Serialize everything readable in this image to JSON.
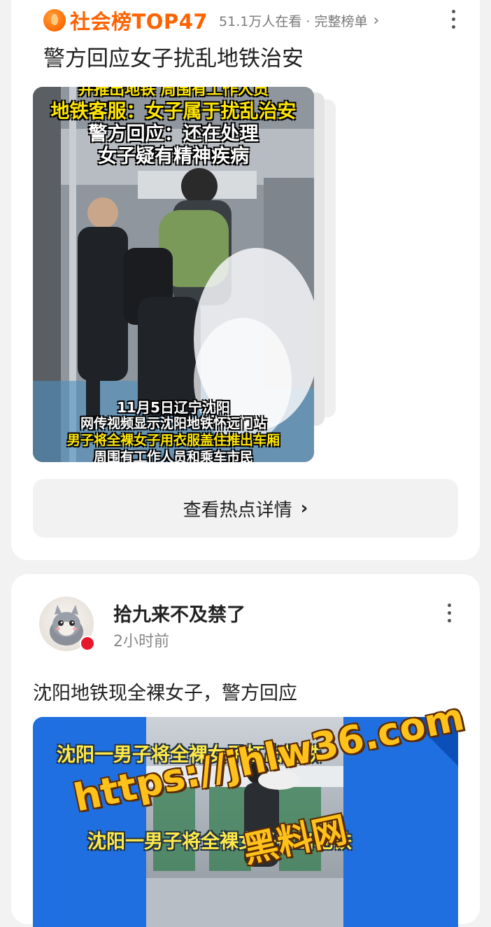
{
  "hot_card": {
    "rank_label": "社会榜TOP47",
    "viewers": "51.1万人在看",
    "separator": "·",
    "full_list_link": "完整榜单",
    "chevron": "›",
    "headline": "警方回应女子扰乱地铁治安",
    "image_captions_top": [
      "并推出地铁 周围有工作人员",
      "地铁客服：女子属于扰乱治安",
      "警方回应：还在处理",
      "女子疑有精神疾病"
    ],
    "image_captions_bottom": [
      "11月5日辽宁沈阳",
      "网传视频显示沈阳地铁怀远门站",
      "男子将全裸女子用衣服盖住推出车厢",
      "周围有工作人员和乘车市民"
    ],
    "detail_button": "查看热点详情",
    "detail_chevron": "›",
    "menu_icon": "more-vertical-icon"
  },
  "post_card": {
    "author": "拾九来不及禁了",
    "time": "2小时前",
    "text": "沈阳地铁现全裸女子，警方回应",
    "image_caption_1": "沈阳一男子将全裸女子扛出地铁",
    "image_caption_2": "沈阳一男子将全裸女子扛出地铁",
    "menu_icon": "more-vertical-icon"
  },
  "watermark": {
    "url": "https://jhlw36.com",
    "name": "黑料网"
  },
  "colors": {
    "accent": "#ff6200",
    "page_bg": "#f2f2f2",
    "card_bg": "#ffffff",
    "caption_yellow": "#ffe600",
    "post_image_blue": "#1f6fe0",
    "watermark": "#ffc21a"
  }
}
